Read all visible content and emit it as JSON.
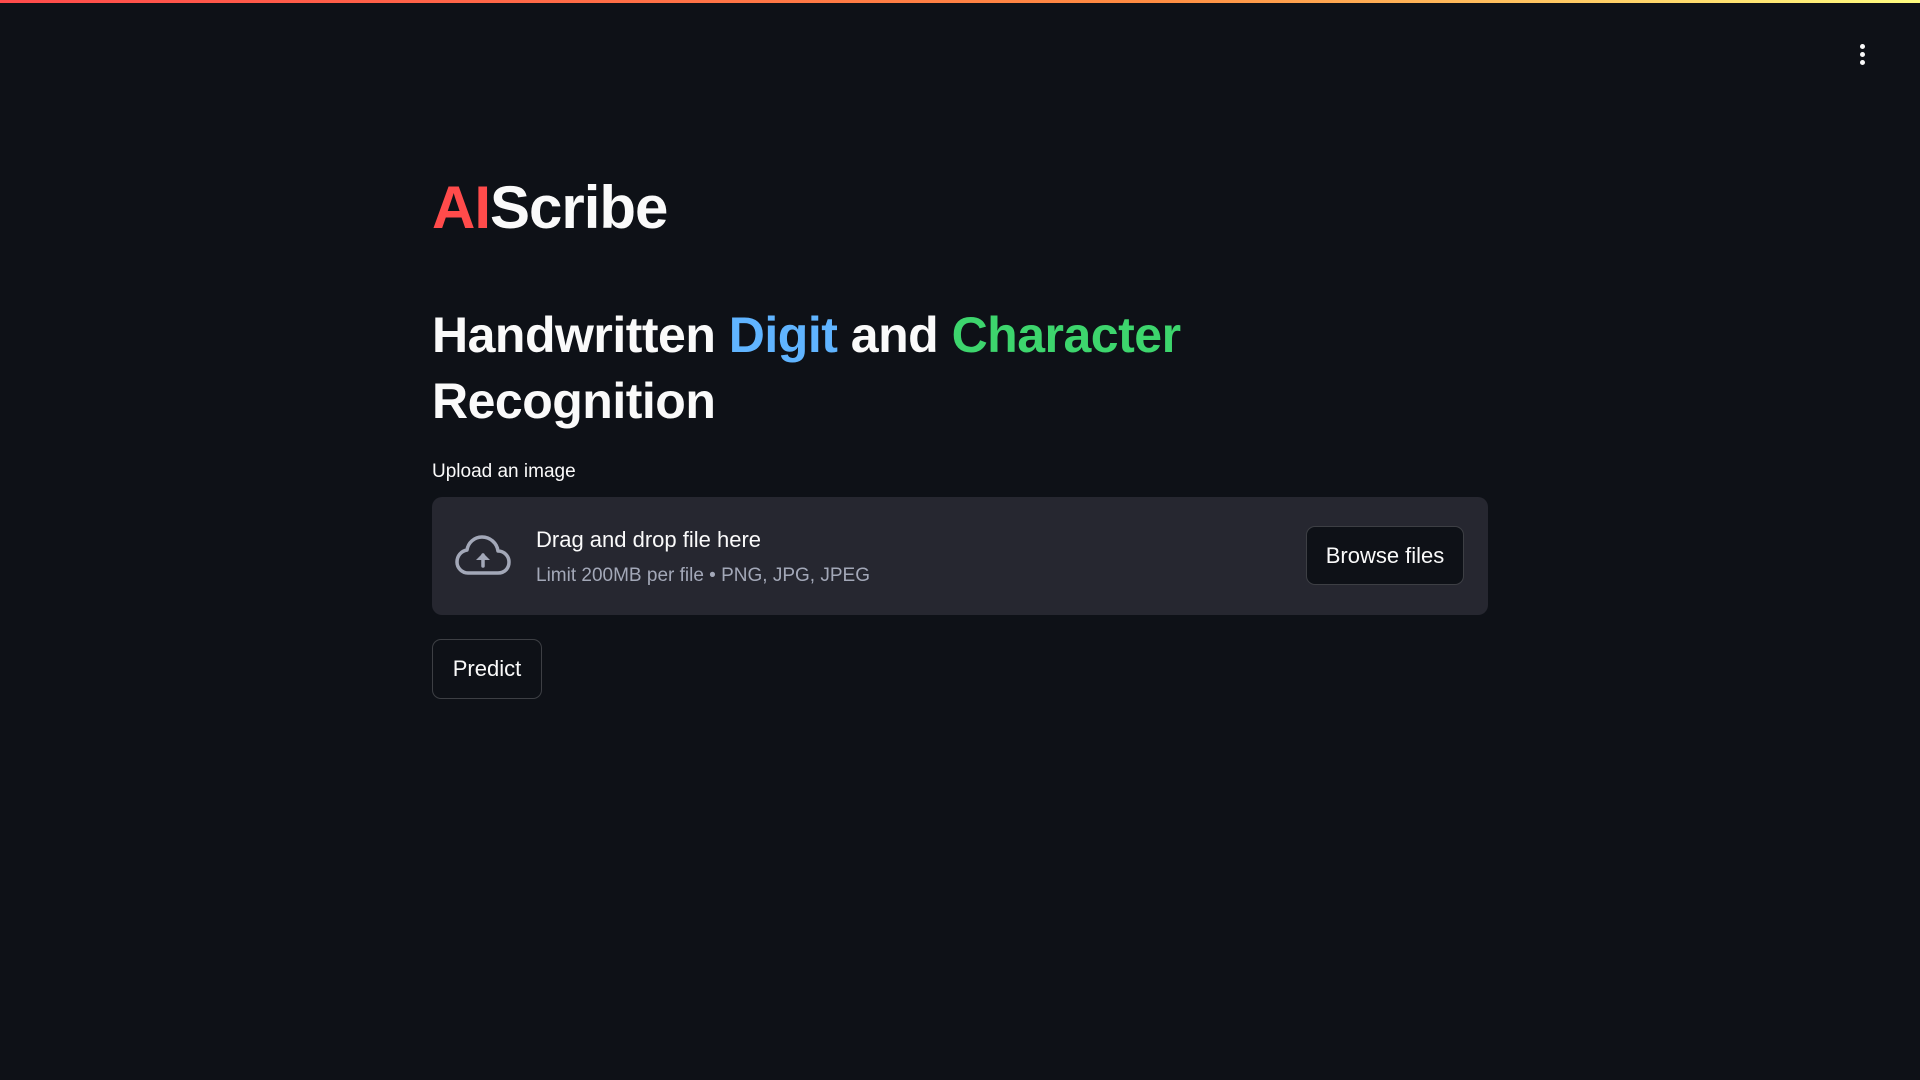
{
  "header": {
    "menu_icon": "kebab-menu-icon"
  },
  "title": {
    "accent": "AI",
    "rest": "Scribe",
    "accent_color": "#ff4b4b"
  },
  "subtitle": {
    "part1": "Handwritten ",
    "digit": "Digit",
    "part2": " and ",
    "character": "Character",
    "part3": "Recognition",
    "digit_color": "#60b4ff",
    "character_color": "#3dd56d"
  },
  "uploader": {
    "label": "Upload an image",
    "icon": "cloud-upload-icon",
    "drop_text": "Drag and drop file here",
    "limit_text": "Limit 200MB per file • PNG, JPG, JPEG",
    "browse_label": "Browse files"
  },
  "actions": {
    "predict_label": "Predict"
  },
  "colors": {
    "background": "#0e1117",
    "surface": "#262730",
    "text": "#fafafa",
    "muted": "#a3a8b8"
  }
}
